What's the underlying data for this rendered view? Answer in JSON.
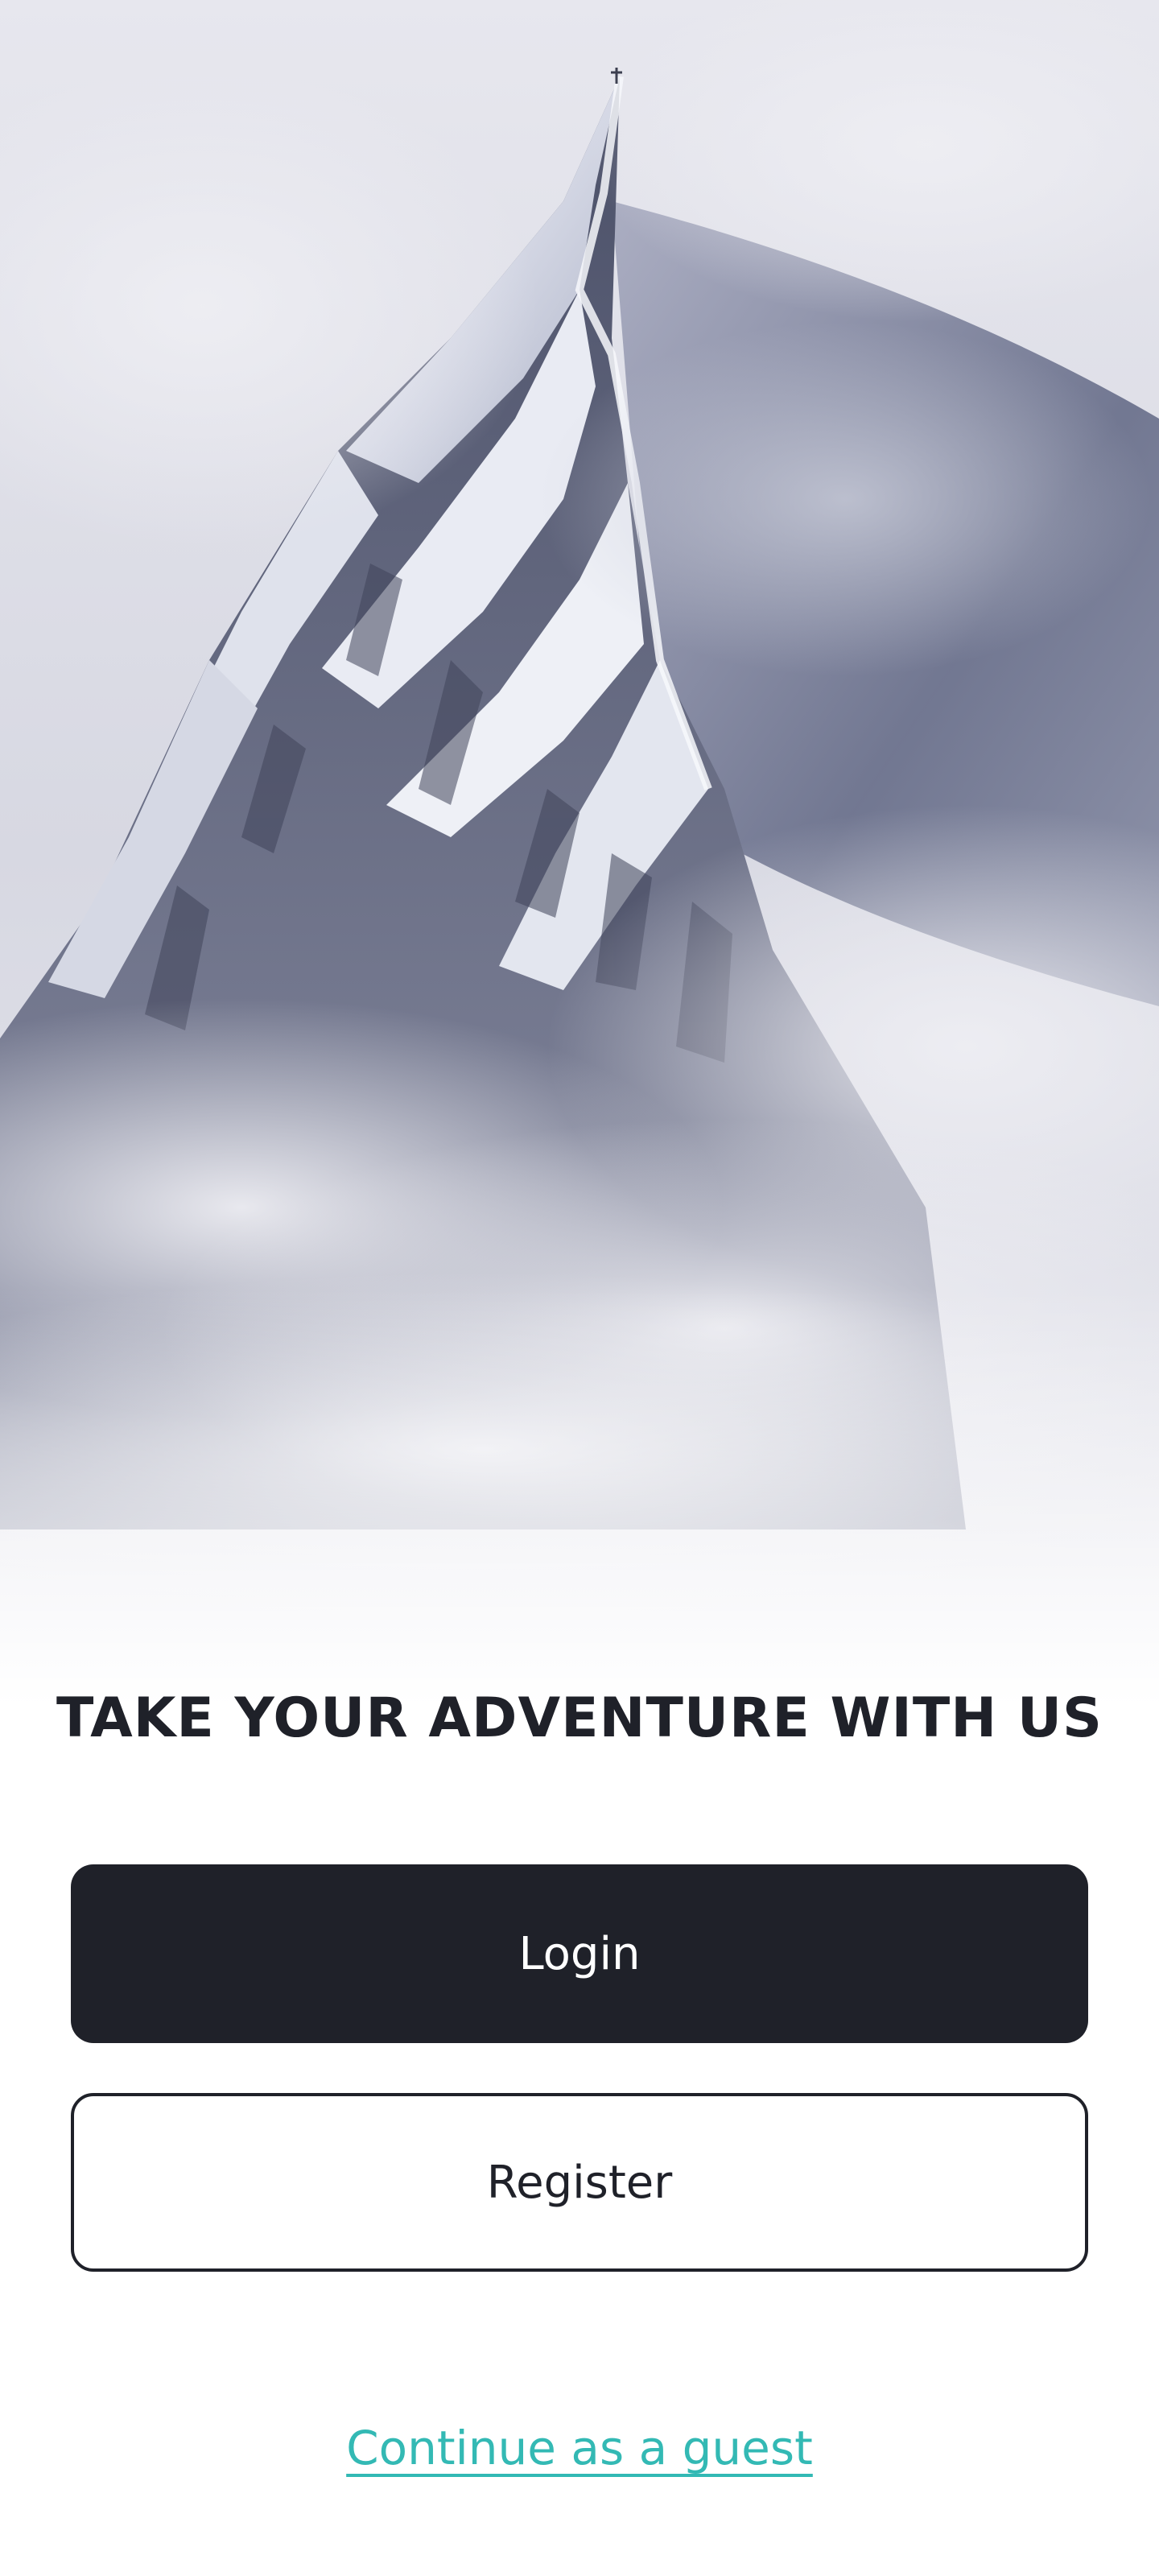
{
  "hero": {
    "image": "snowy-mountain-peak-in-clouds"
  },
  "headline": "TAKE YOUR ADVENTURE WITH US",
  "buttons": {
    "login_label": "Login",
    "register_label": "Register"
  },
  "guest_link_label": "Continue as a guest",
  "colors": {
    "primary": "#1f2129",
    "accent": "#33b9b4",
    "background": "#ffffff"
  }
}
